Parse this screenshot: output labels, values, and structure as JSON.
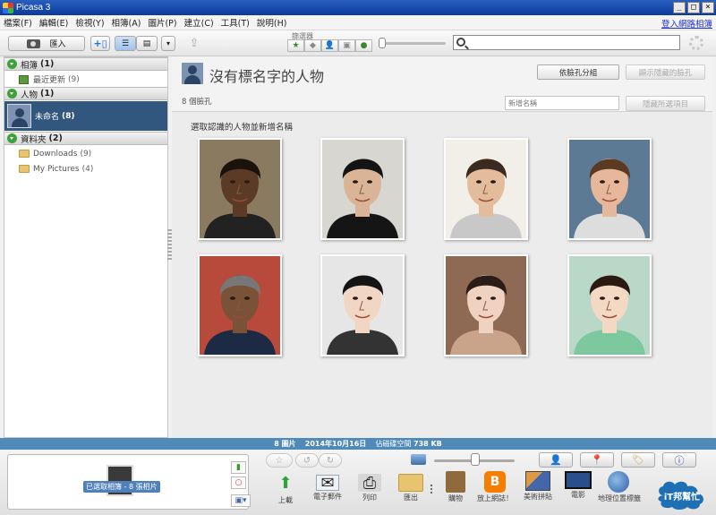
{
  "window": {
    "title": "Picasa 3",
    "controls": [
      "_",
      "□",
      "×"
    ]
  },
  "menu": {
    "items": [
      "檔案(F)",
      "編輯(E)",
      "檢視(Y)",
      "相簿(A)",
      "圖片(P)",
      "建立(C)",
      "工具(T)",
      "說明(H)"
    ],
    "signin_link": "登入網路相簿"
  },
  "toolbar": {
    "import_label": "匯入",
    "filters_label": "篩選器",
    "search": {
      "value": "",
      "placeholder": ""
    }
  },
  "sidebar": {
    "albums": {
      "title": "相簿",
      "count": "(1)",
      "items": [
        {
          "label": "最近更新",
          "count": "(9)"
        }
      ]
    },
    "people": {
      "title": "人物",
      "count": "(1)",
      "items": [
        {
          "label": "未命名",
          "count": "(8)",
          "selected": true
        }
      ]
    },
    "folders": {
      "title": "資料夾",
      "count": "(2)",
      "items": [
        {
          "label": "Downloads",
          "count": "(9)"
        },
        {
          "label": "My Pictures",
          "count": "(4)"
        }
      ]
    }
  },
  "main": {
    "title": "沒有標名字的人物",
    "face_count": "8 個臉孔",
    "group_button": "依臉孔分組",
    "show_hidden_button": "顯示隱藏的臉孔",
    "name_input_placeholder": "新增名稱",
    "hide_selected_button": "隱藏所選項目",
    "instruction": "選取認識的人物並新增名稱",
    "faces": [
      {
        "name": "face-1",
        "skin": "#5b3a26",
        "hair": "#1a120c",
        "bg": "#8a7a60",
        "shirt": "#222"
      },
      {
        "name": "face-2",
        "skin": "#d9b497",
        "hair": "#141414",
        "bg": "#d8d6d0",
        "shirt": "#151515"
      },
      {
        "name": "face-3",
        "skin": "#e3bc9c",
        "hair": "#3a2a20",
        "bg": "#f2eee8",
        "shirt": "#c8c8c8"
      },
      {
        "name": "face-4",
        "skin": "#e6b79a",
        "hair": "#5a3a22",
        "bg": "#5c7a94",
        "shirt": "#ddd"
      },
      {
        "name": "face-5",
        "skin": "#7a5238",
        "hair": "#777",
        "bg": "#b84a3c",
        "shirt": "#1d2a44"
      },
      {
        "name": "face-6",
        "skin": "#f2d6c4",
        "hair": "#141414",
        "bg": "#e6e6e6",
        "shirt": "#333"
      },
      {
        "name": "face-7",
        "skin": "#efd2bf",
        "hair": "#2a1c18",
        "bg": "#8e6a54",
        "shirt": "#c9a48a"
      },
      {
        "name": "face-8",
        "skin": "#f3d8c4",
        "hair": "#2a1a12",
        "bg": "#b9d8c8",
        "shirt": "#7ec8a0"
      }
    ]
  },
  "status": {
    "images": "8 圖片",
    "date": "2014年10月16日",
    "disk_label": "佔磁碟空間",
    "size": "738 KB"
  },
  "tray": {
    "label": "已選取相簿 - 8 張相片"
  },
  "actions": [
    {
      "name": "upload",
      "label": "上載"
    },
    {
      "name": "email",
      "label": "電子郵件"
    },
    {
      "name": "print",
      "label": "列印"
    },
    {
      "name": "export",
      "label": "匯出"
    },
    {
      "name": "shop",
      "label": "購物"
    },
    {
      "name": "blog",
      "label": "放上網誌！"
    },
    {
      "name": "collage",
      "label": "美術拼貼"
    },
    {
      "name": "movie",
      "label": "電影"
    },
    {
      "name": "geotag",
      "label": "地理位置標籤"
    }
  ],
  "watermark": {
    "text": "iT邦幫忙"
  },
  "colors": {
    "selection": "#31577f",
    "statusbar": "#4f8ab8",
    "titlebar": "#0a3a9a"
  }
}
